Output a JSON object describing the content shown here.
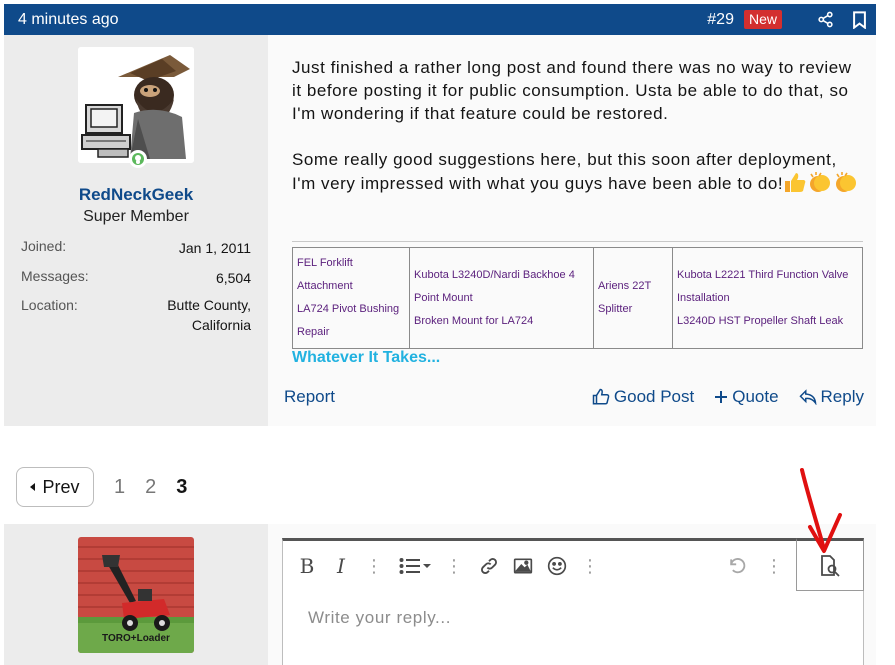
{
  "post": {
    "time": "4 minutes ago",
    "number": "#29",
    "new_badge": "New",
    "icons": [
      "share-icon",
      "bookmark-icon"
    ]
  },
  "user": {
    "name": "RedNeckGeek",
    "title": "Super Member",
    "stats": [
      {
        "label": "Joined:",
        "value": "Jan 1, 2011"
      },
      {
        "label": "Messages:",
        "value": "6,504"
      },
      {
        "label": "Location:",
        "value": "Butte County, California"
      }
    ]
  },
  "message": {
    "para1": "Just finished a rather long post and found there was no way to review it before posting it for public consumption. Usta be able to do that, so I'm wondering if that feature could be restored.",
    "para2": "Some really good suggestions here, but this soon after deployment, I'm very impressed with what you guys have been able to do!",
    "emojis": [
      "thumbs-up-emoji",
      "clapping-hands-emoji",
      "clapping-hands-emoji"
    ]
  },
  "signature": {
    "links": [
      [
        "FEL Forklift Attachment",
        "LA724 Pivot Bushing Repair"
      ],
      [
        "Kubota L3240D/Nardi Backhoe 4 Point Mount",
        "Broken Mount for LA724"
      ],
      [
        "Ariens 22T Splitter"
      ],
      [
        "Kubota L2221 Third Function Valve Installation",
        "L3240D HST Propeller Shaft Leak"
      ]
    ],
    "tagline": "Whatever It Takes..."
  },
  "actions": {
    "report": "Report",
    "good_post": "Good Post",
    "quote": "Quote",
    "reply": "Reply"
  },
  "pagination": {
    "prev": "Prev",
    "pages": [
      "1",
      "2",
      "3"
    ],
    "current": "3"
  },
  "reply_user": {
    "avatar_caption": "TORO+Loader"
  },
  "editor": {
    "placeholder": "Write your reply...",
    "tools": [
      "bold",
      "italic",
      "more",
      "list",
      "more",
      "link",
      "image",
      "smilie",
      "more",
      "undo",
      "more",
      "preview"
    ]
  },
  "colors": {
    "header_bg": "#0f4a8a",
    "badge_new": "#d32f2f",
    "username": "#0f4a8a",
    "sig_link": "#5a1f7c",
    "tagline": "#22b2e0",
    "annotation_arrow": "#e01010"
  }
}
